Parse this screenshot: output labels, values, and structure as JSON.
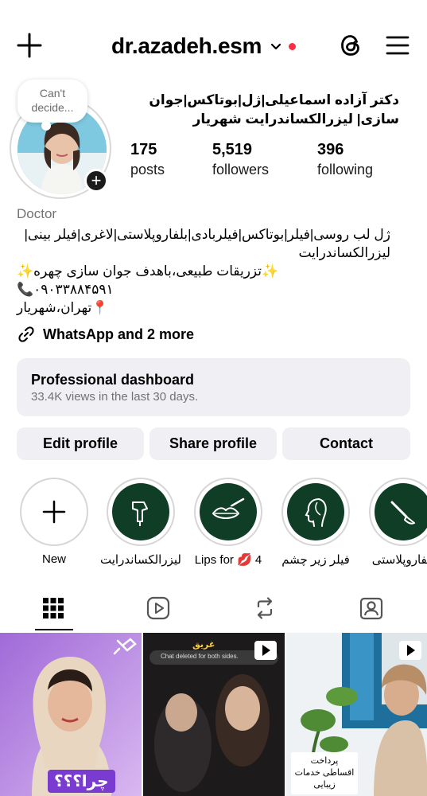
{
  "header": {
    "username": "dr.azadeh.esm",
    "create_icon": "plus-icon",
    "threads_icon": "threads-icon",
    "menu_icon": "hamburger-menu-icon",
    "notification_color": "#ff2c45"
  },
  "profile": {
    "note": "Can't decide...",
    "full_name": "دکتر آزاده اسماعیلی|ژل|بوتاکس|جوان سازی| لیزرالکساندرایت شهریار",
    "stats": {
      "posts_count": "175",
      "posts_label": "posts",
      "followers_count": "5,519",
      "followers_label": "followers",
      "following_count": "396",
      "following_label": "following"
    },
    "category": "Doctor",
    "bio": {
      "line1": "ژل لب روسی|فیلر|بوتاکس|فیلربادی|بلفاروپلاستی|لاغری|فیلر بینی| لیزرالکساندرایت",
      "line2": "✨تزریقات طبیعی،باهدف جوان سازی چهره✨",
      "line3": "📞۰۹۰۳۳۸۸۴۵۹۱",
      "line4": "📍تهران،شهریار"
    },
    "links_text": "WhatsApp and 2 more"
  },
  "dashboard": {
    "title": "Professional dashboard",
    "subtitle": "33.4K views in the last 30 days."
  },
  "buttons": {
    "edit": "Edit profile",
    "share": "Share profile",
    "contact": "Contact"
  },
  "highlights": [
    {
      "label": "New",
      "icon": "plus-icon"
    },
    {
      "label": "لیزرالکساندرایت",
      "icon": "laser-device-icon"
    },
    {
      "label": "Lips for 💋 4",
      "icon": "lips-syringe-icon"
    },
    {
      "label": "فیلر زیر چشم",
      "icon": "face-profile-icon"
    },
    {
      "label": "بلفاروپلاستی",
      "icon": "scalpel-icon"
    }
  ],
  "tabs": [
    {
      "name": "posts-grid",
      "icon": "grid-icon",
      "active": true
    },
    {
      "name": "reels",
      "icon": "reels-icon",
      "active": false
    },
    {
      "name": "reposts",
      "icon": "repost-icon",
      "active": false
    },
    {
      "name": "tagged",
      "icon": "tagged-icon",
      "active": false
    }
  ],
  "grid_posts": {
    "post1_caption": "چرا؟؟؟",
    "post2_title_small": "غریق",
    "post2_chat": "Chat deleted for both sides.",
    "post3_caption": "پرداخت اقساطی خدمات زیبایی"
  },
  "colors": {
    "button_bg": "#efeff4",
    "highlight_bg": "#0f3d25",
    "muted_text": "#737373"
  }
}
